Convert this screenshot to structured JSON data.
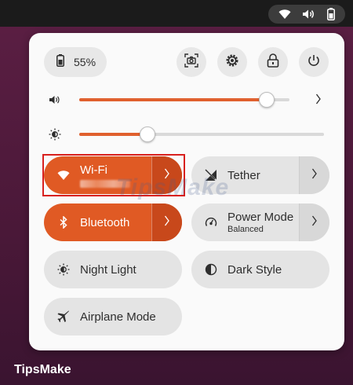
{
  "status_bar": {
    "icons": [
      "wifi-icon",
      "volume-icon",
      "battery-icon"
    ]
  },
  "battery": {
    "icon": "battery-icon",
    "percent": "55%"
  },
  "quick_actions": [
    {
      "name": "screenshot-button",
      "icon": "screenshot-icon"
    },
    {
      "name": "settings-button",
      "icon": "gear-icon"
    },
    {
      "name": "lock-button",
      "icon": "lock-icon"
    },
    {
      "name": "power-button",
      "icon": "power-icon"
    }
  ],
  "volume": {
    "icon": "speaker-icon",
    "level": 0.89
  },
  "brightness": {
    "icon": "sun-icon",
    "level": 0.28
  },
  "tiles": {
    "wifi": {
      "label": "Wi-Fi",
      "active": true,
      "icon": "wifi-icon"
    },
    "tether": {
      "label": "Tether",
      "active": false,
      "icon": "tether-icon"
    },
    "bluetooth": {
      "label": "Bluetooth",
      "active": true,
      "icon": "bluetooth-icon"
    },
    "power_mode": {
      "label": "Power Mode",
      "sub": "Balanced",
      "active": false,
      "icon": "power-mode-icon"
    },
    "night_light": {
      "label": "Night Light",
      "active": false,
      "icon": "night-light-icon"
    },
    "dark_style": {
      "label": "Dark Style",
      "active": false,
      "icon": "dark-style-icon"
    },
    "airplane": {
      "label": "Airplane Mode",
      "active": false,
      "icon": "airplane-icon"
    }
  },
  "watermark": "TipsMake",
  "footer_brand": "TipsMake",
  "colors": {
    "accent": "#e05a24",
    "accent_dark": "#c8481b",
    "highlight": "#d8201e",
    "panel": "#fafafa",
    "chip": "#e8e8e8"
  }
}
